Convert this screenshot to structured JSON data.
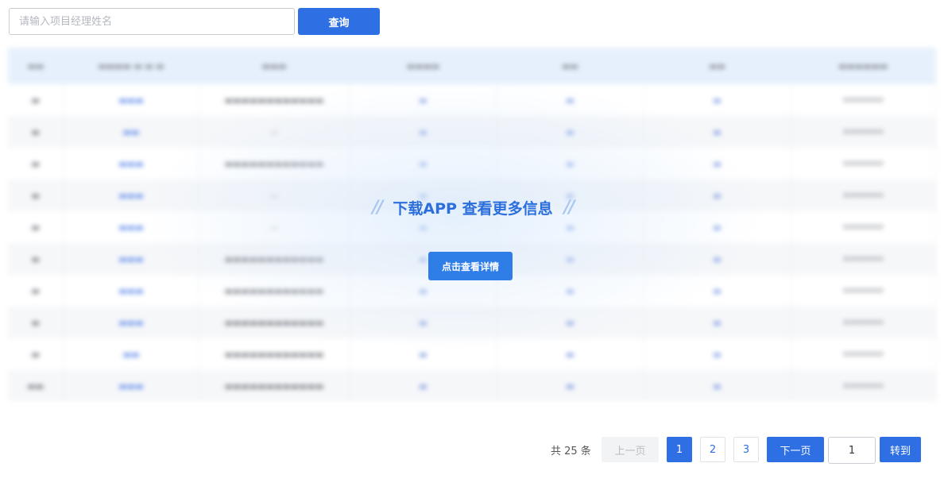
{
  "search": {
    "placeholder": "请输入项目经理姓名",
    "button_label": "查询"
  },
  "overlay": {
    "title": "下载APP 查看更多信息",
    "slashes": "//",
    "button_label": "点击查看详情"
  },
  "pagination": {
    "total_label": "共 25 条",
    "prev_label": "上一页",
    "pages": [
      "1",
      "2",
      "3"
    ],
    "current_page": "1",
    "next_label": "下一页",
    "jump_value": "1",
    "jump_label": "转到"
  },
  "colors": {
    "accent": "#2f6fe4",
    "header_bg": "#e6f0fc"
  }
}
